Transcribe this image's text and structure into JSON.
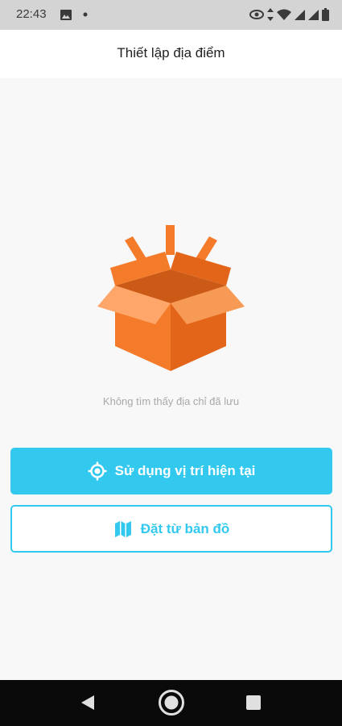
{
  "status_bar": {
    "time": "22:43",
    "left_icons": [
      "image-icon",
      "dot-icon"
    ],
    "right_icons": [
      "eye-icon",
      "data-arrows-icon",
      "wifi-icon",
      "signal-icon",
      "signal-icon",
      "battery-icon"
    ]
  },
  "app_bar": {
    "title": "Thiết lập địa điểm"
  },
  "empty_state": {
    "illustration": "open-box-icon",
    "message": "Không tìm thấy địa chỉ đã lưu"
  },
  "actions": {
    "use_current_location": {
      "label": "Sử dụng vị trí hiện tại",
      "icon": "location-target-icon"
    },
    "set_from_map": {
      "label": "Đặt từ bản đồ",
      "icon": "map-icon"
    }
  },
  "colors": {
    "accent": "#33c9ef",
    "box_orange": "#f47b2a",
    "box_dark": "#e2651a",
    "box_light": "#ffa76a",
    "status_bar_bg": "#d4d4d4",
    "nav_bar_bg": "#0a0a0a",
    "message_text": "#a9a9a9"
  },
  "nav_bar": {
    "buttons": [
      "back-icon",
      "home-icon",
      "recents-icon"
    ]
  }
}
